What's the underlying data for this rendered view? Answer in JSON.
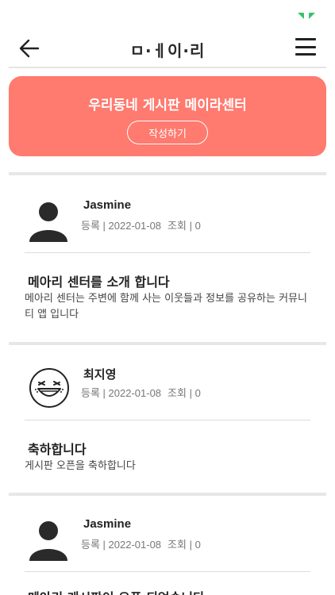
{
  "header": {
    "logo_text": "ㅁ·ㅔ이·리",
    "back_icon": "arrow-left-icon",
    "menu_icon": "hamburger-menu-icon"
  },
  "banner": {
    "title": "우리동네 게시판 메이라센터",
    "write_button": "작성하기",
    "color": "#ff7a6f"
  },
  "posts": [
    {
      "author": "Jasmine",
      "reg_label": "등록",
      "date": "2022-01-08",
      "views_label": "조회",
      "views": "0",
      "avatar_icon": "person-silhouette-icon",
      "title": "메아리 센터를 소개 합니다",
      "body": "메아리 센터는 주변에 함께 사는 이웃들과 정보를 공유하는 커뮤니티 앱 입니다"
    },
    {
      "author": "최지영",
      "reg_label": "등록",
      "date": "2022-01-08",
      "views_label": "조회",
      "views": "0",
      "avatar_icon": "laughing-face-icon",
      "title": "축하합니다",
      "body": "게시판 오픈을 축하합니다"
    },
    {
      "author": "Jasmine",
      "reg_label": "등록",
      "date": "2022-01-08",
      "views_label": "조회",
      "views": "0",
      "avatar_icon": "person-silhouette-icon",
      "title": "메아리 게시판이 오픈 되었습니다",
      "body": ""
    }
  ]
}
